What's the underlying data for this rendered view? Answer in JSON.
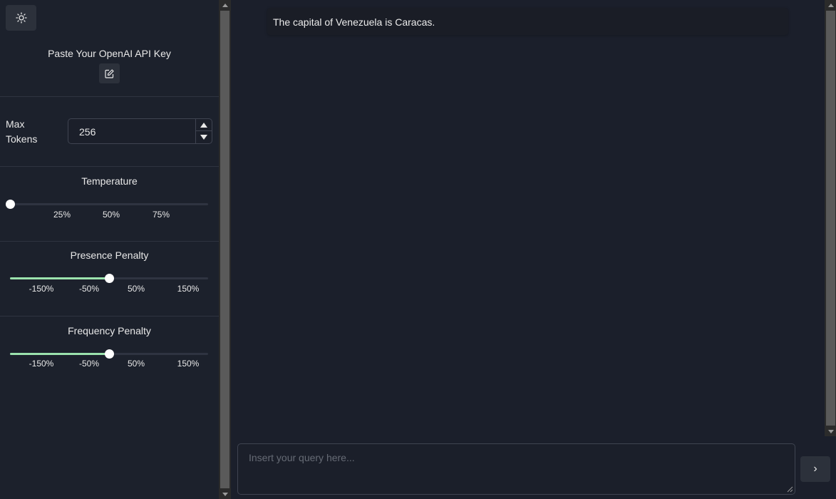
{
  "sidebar": {
    "api_key_label": "Paste Your OpenAI API Key",
    "max_tokens": {
      "label_line1": "Max",
      "label_line2": "Tokens",
      "value": "256"
    },
    "temperature": {
      "title": "Temperature",
      "value_fraction": 0.0,
      "ticks": [
        "25%",
        "50%",
        "75%"
      ]
    },
    "presence_penalty": {
      "title": "Presence Penalty",
      "value_fraction": 0.5,
      "ticks": [
        "-150%",
        "-50%",
        "50%",
        "150%"
      ]
    },
    "frequency_penalty": {
      "title": "Frequency Penalty",
      "value_fraction": 0.5,
      "ticks": [
        "-150%",
        "-50%",
        "50%",
        "150%"
      ]
    }
  },
  "chat": {
    "messages": [
      "The capital of Venezuela is Caracas."
    ],
    "input_placeholder": "Insert your query here...",
    "send_label": "›"
  },
  "colors": {
    "slider_fill": "#9be2ad",
    "background": "#1b1f2b",
    "button_bg": "#2c313b"
  },
  "icons": [
    "sun-icon",
    "edit-icon",
    "chevron-right-icon"
  ]
}
